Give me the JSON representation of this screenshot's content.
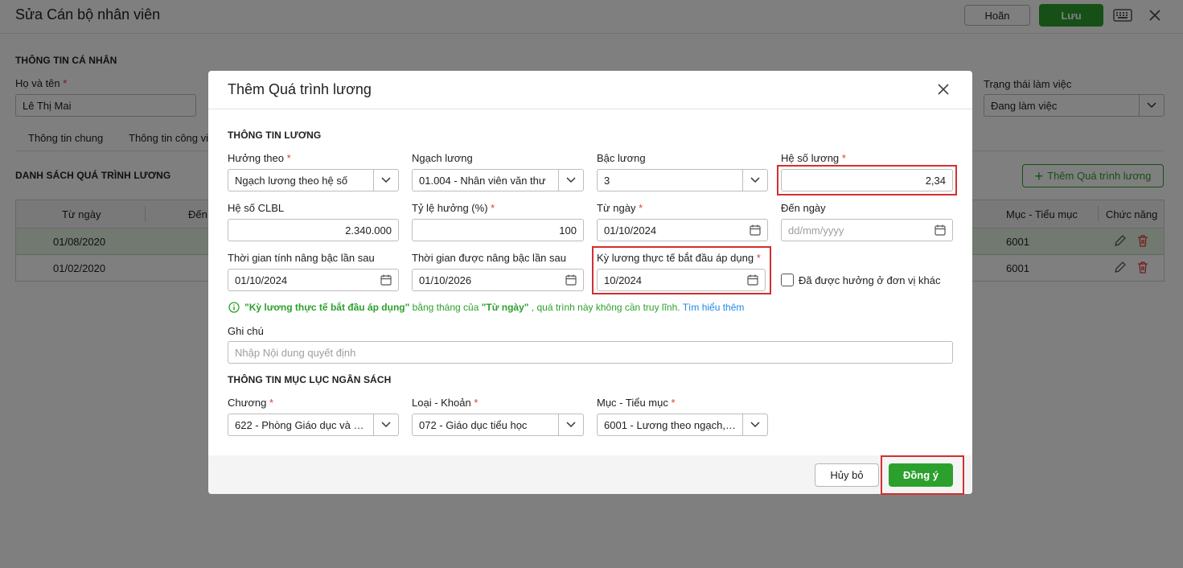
{
  "page": {
    "title": "Sửa Cán bộ nhân viên",
    "cancel_label": "Hoãn",
    "save_label": "Lưu"
  },
  "personal": {
    "section_title": "THÔNG TIN CÁ NHÂN",
    "name_label": "Họ và tên",
    "name_value": "Lê Thị Mai",
    "status_label": "Trạng thái làm việc",
    "status_value": "Đang làm việc"
  },
  "tabs": [
    "Thông tin chung",
    "Thông tin công vi"
  ],
  "salary_list": {
    "title": "DANH SÁCH QUÁ TRÌNH LƯƠNG",
    "add_label": "Thêm Quá trình lương",
    "columns": [
      "Từ ngày",
      "Đến",
      "Mục - Tiểu mục",
      "Chức năng"
    ],
    "rows": [
      {
        "from": "01/08/2020",
        "muc": "6001"
      },
      {
        "from": "01/02/2020",
        "muc": "6001"
      }
    ]
  },
  "dialog": {
    "title": "Thêm Quá trình lương",
    "salary_section": "THÔNG TIN LƯƠNG",
    "huong_theo": {
      "label": "Hưởng theo",
      "value": "Ngạch lương theo hệ số"
    },
    "ngach_luong": {
      "label": "Ngạch lương",
      "value": "01.004 - Nhân viên văn thư"
    },
    "bac_luong": {
      "label": "Bậc lương",
      "value": "3"
    },
    "he_so_luong": {
      "label": "Hệ số lương",
      "value": "2,34"
    },
    "he_so_clbl": {
      "label": "Hệ số CLBL",
      "value": "2.340.000"
    },
    "ty_le_huong": {
      "label": "Tỷ lệ hưởng (%)",
      "value": "100"
    },
    "tu_ngay": {
      "label": "Từ ngày",
      "value": "01/10/2024"
    },
    "den_ngay": {
      "label": "Đến ngày",
      "placeholder": "dd/mm/yyyy"
    },
    "tg_tinh_nang_bac": {
      "label": "Thời gian tính nâng bậc lần sau",
      "value": "01/10/2024"
    },
    "tg_duoc_nang_bac": {
      "label": "Thời gian được nâng bậc lần sau",
      "value": "01/10/2026"
    },
    "ky_luong": {
      "label": "Kỳ lương thực tế bắt đầu áp dụng",
      "value": "10/2024"
    },
    "checkbox_label": "Đã được hưởng ở đơn vị khác",
    "info": {
      "part1": "\"Kỳ lương thực tế bắt đầu áp dụng\"",
      "part2": " bằng tháng của ",
      "part3": "\"Từ ngày\"",
      "part4": " , quá trình này không cần truy lĩnh. ",
      "link": "Tìm hiểu thêm"
    },
    "ghi_chu": {
      "label": "Ghi chú",
      "placeholder": "Nhập Nội dung quyết định"
    },
    "budget_section": "THÔNG TIN MỤC LỤC NGÂN SÁCH",
    "chuong": {
      "label": "Chương",
      "value": "622 - Phòng Giáo dục và Đ..."
    },
    "loai_khoan": {
      "label": "Loại - Khoản",
      "value": "072 - Giáo dục tiểu học"
    },
    "muc_tieu_muc": {
      "label": "Mục - Tiểu mục",
      "value": "6001 - Lương theo ngạch, ..."
    },
    "cancel_label": "Hủy bỏ",
    "ok_label": "Đồng ý"
  },
  "colors": {
    "accent_green": "#2ca02c",
    "required": "#e53935",
    "highlight": "#d32f2f",
    "link": "#1e88e5"
  }
}
